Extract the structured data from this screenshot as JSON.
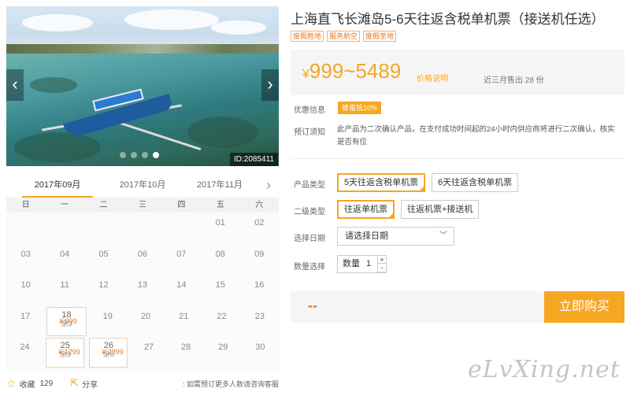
{
  "gallery": {
    "photo_id": "ID:2085411",
    "prev_icon": "chevron-left-icon",
    "next_icon": "chevron-right-icon",
    "slide_count": 4,
    "active_slide": 4
  },
  "calendar": {
    "months": [
      "2017年09月",
      "2017年10月",
      "2017年11月"
    ],
    "active_month": "2017年09月",
    "weekdays": [
      "日",
      "一",
      "二",
      "三",
      "四",
      "五",
      "六"
    ],
    "weeks": [
      [
        {
          "d": ""
        },
        {
          "d": ""
        },
        {
          "d": ""
        },
        {
          "d": ""
        },
        {
          "d": ""
        },
        {
          "d": "01"
        },
        {
          "d": "02"
        }
      ],
      [
        {
          "d": "03"
        },
        {
          "d": "04"
        },
        {
          "d": "05"
        },
        {
          "d": "06"
        },
        {
          "d": "07"
        },
        {
          "d": "08"
        },
        {
          "d": "09"
        }
      ],
      [
        {
          "d": "10"
        },
        {
          "d": "11"
        },
        {
          "d": "12"
        },
        {
          "d": "13"
        },
        {
          "d": "14"
        },
        {
          "d": "15"
        },
        {
          "d": "16"
        }
      ],
      [
        {
          "d": "17"
        },
        {
          "d": "18",
          "price": "¥ 999",
          "left": "余3"
        },
        {
          "d": "19"
        },
        {
          "d": "20"
        },
        {
          "d": "21"
        },
        {
          "d": "22"
        },
        {
          "d": "23"
        }
      ],
      [
        {
          "d": "24"
        },
        {
          "d": "25",
          "price": "¥ 1299",
          "left": "余3"
        },
        {
          "d": "26",
          "price": "¥ 2999",
          "left": "余6"
        },
        {
          "d": "27"
        },
        {
          "d": "28"
        },
        {
          "d": "29"
        },
        {
          "d": "30"
        }
      ]
    ]
  },
  "footer": {
    "favorite_label": "收藏",
    "favorite_count": "129",
    "share_label": "分享",
    "note": ": 如需预订更多人数请咨询客服"
  },
  "product": {
    "title": "上海直飞长滩岛5-6天往返含税单机票（接送机任选）",
    "tags": [
      "度假胜地",
      "服务航空",
      "度假圣地"
    ],
    "price": "999~5489",
    "currency": "¥",
    "price_note": "价格说明",
    "sold_text": "近三月售出 28 份"
  },
  "info": {
    "promo_label": "优惠信息",
    "promo_badge": "蜂蜜抵10%",
    "notice_label": "预订须知",
    "notice_text": "此产品为二次确认产品，在支付成功时间起的24小时内供应商将进行二次确认，核实是否有位"
  },
  "options": {
    "product_type_label": "产品类型",
    "product_types": [
      "5天往返含税单机票",
      "6天往返含税单机票"
    ],
    "sub_type_label": "二级类型",
    "sub_types": [
      "往返单机票",
      "往返机票+接送机"
    ],
    "date_label": "选择日期",
    "date_placeholder": "请选择日期",
    "qty_label": "数量选择",
    "qty_unit": "数量",
    "qty_value": "1",
    "qty_plus": "+",
    "qty_minus": "-"
  },
  "buy": {
    "price": "--",
    "button": "立即购买"
  },
  "watermark": "eLvXing.net",
  "colors": {
    "accent": "#f5a623",
    "price": "#e8761e"
  }
}
